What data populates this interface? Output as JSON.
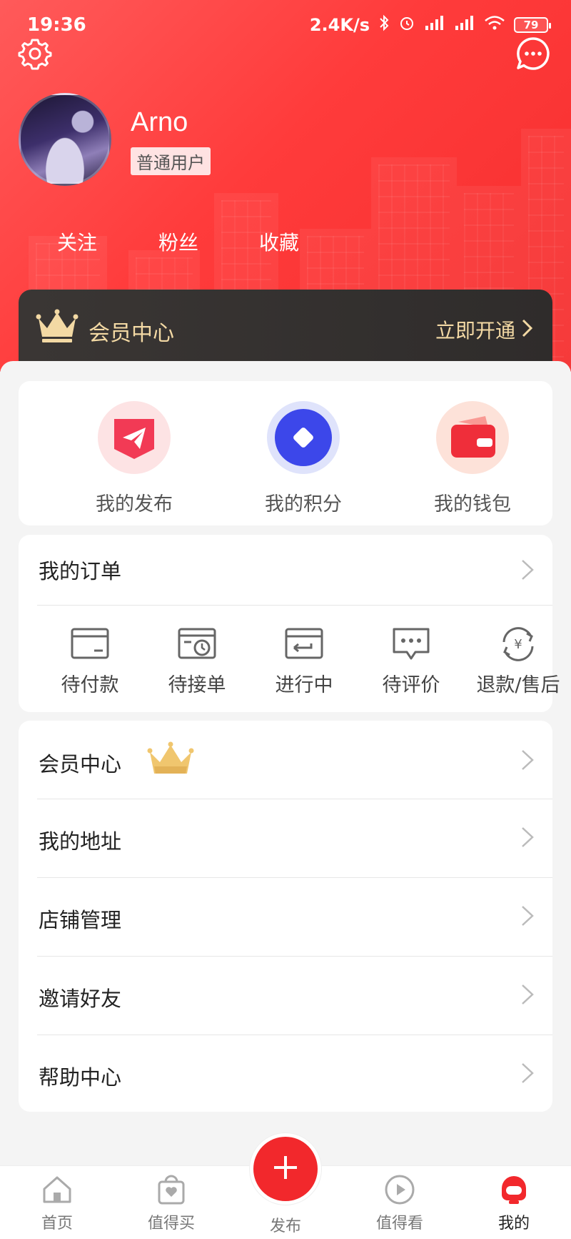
{
  "status_bar": {
    "time": "19:36",
    "speed": "2.4K/s",
    "battery": "79"
  },
  "profile": {
    "name": "Arno",
    "badge": "普通用户"
  },
  "stats": [
    {
      "label": "关注"
    },
    {
      "label": "粉丝"
    },
    {
      "label": "收藏"
    }
  ],
  "vip": {
    "title": "会员中心",
    "action": "立即开通"
  },
  "quick_actions": [
    {
      "label": "我的发布",
      "icon": "send-icon"
    },
    {
      "label": "我的积分",
      "icon": "points-icon"
    },
    {
      "label": "我的钱包",
      "icon": "wallet-icon"
    }
  ],
  "orders": {
    "title": "我的订单",
    "items": [
      {
        "label": "待付款",
        "icon": "card-icon"
      },
      {
        "label": "待接单",
        "icon": "clock-icon"
      },
      {
        "label": "进行中",
        "icon": "progress-icon"
      },
      {
        "label": "待评价",
        "icon": "comment-icon"
      },
      {
        "label": "退款/售后",
        "icon": "refund-icon"
      }
    ]
  },
  "menu": [
    {
      "label": "会员中心",
      "icon": "crown-icon"
    },
    {
      "label": "我的地址"
    },
    {
      "label": "店铺管理"
    },
    {
      "label": "邀请好友"
    },
    {
      "label": "帮助中心"
    }
  ],
  "tabbar": [
    {
      "label": "首页",
      "icon": "home-icon"
    },
    {
      "label": "值得买",
      "icon": "shopping-bag-icon"
    },
    {
      "label": "发布",
      "icon": "plus-icon"
    },
    {
      "label": "值得看",
      "icon": "play-icon"
    },
    {
      "label": "我的",
      "icon": "profile-icon",
      "active": true
    }
  ],
  "colors": {
    "brand_red": "#f2282c",
    "vip_gold": "#f3d9a4",
    "vip_dark": "#332f2e"
  }
}
